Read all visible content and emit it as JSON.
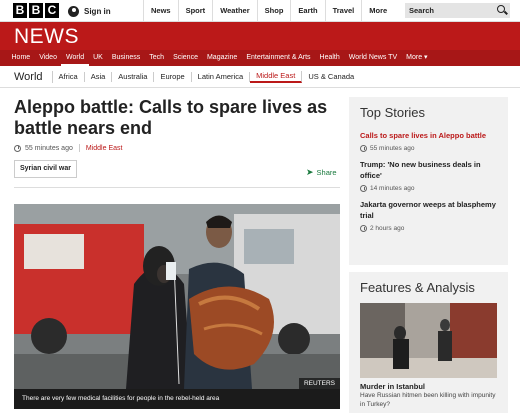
{
  "header": {
    "logo_letters": [
      "B",
      "B",
      "C"
    ],
    "signin_label": "Sign in",
    "nav": [
      "News",
      "Sport",
      "Weather",
      "Shop",
      "Earth",
      "Travel"
    ],
    "more_label": "More",
    "more_chevron": "▾",
    "search_placeholder": "Search"
  },
  "brand": {
    "news_label": "NEWS"
  },
  "main_nav": [
    "Home",
    "Video",
    "World",
    "UK",
    "Business",
    "Tech",
    "Science",
    "Magazine",
    "Entertainment & Arts",
    "Health",
    "World News TV"
  ],
  "main_nav_more": "More ▾",
  "main_nav_active": "World",
  "sub_nav": {
    "section": "World",
    "items": [
      "Africa",
      "Asia",
      "Australia",
      "Europe",
      "Latin America",
      "Middle East",
      "US & Canada"
    ],
    "current": "Middle East"
  },
  "article": {
    "headline": "Aleppo battle: Calls to spare lives as battle nears end",
    "time": "55 minutes ago",
    "section": "Middle East",
    "tag": "Syrian civil war",
    "share_label": "Share",
    "image_caption": "There are very few medical facilities for people in the rebel-held area",
    "image_credit": "REUTERS"
  },
  "top_stories": {
    "title": "Top Stories",
    "items": [
      {
        "title": "Calls to spare lives in Aleppo battle",
        "time": "55 minutes ago"
      },
      {
        "title": "Trump: 'No new business deals in office'",
        "time": "14 minutes ago"
      },
      {
        "title": "Jakarta governor weeps at blasphemy trial",
        "time": "2 hours ago"
      }
    ]
  },
  "features": {
    "title": "Features & Analysis",
    "item_title": "Murder in Istanbul",
    "item_summary": "Have Russian hitmen been killing with impunity in Turkey?"
  },
  "colors": {
    "brand_red": "#bb1919",
    "share_green": "#1a7a3e",
    "panel_bg": "#f1f1f1"
  }
}
